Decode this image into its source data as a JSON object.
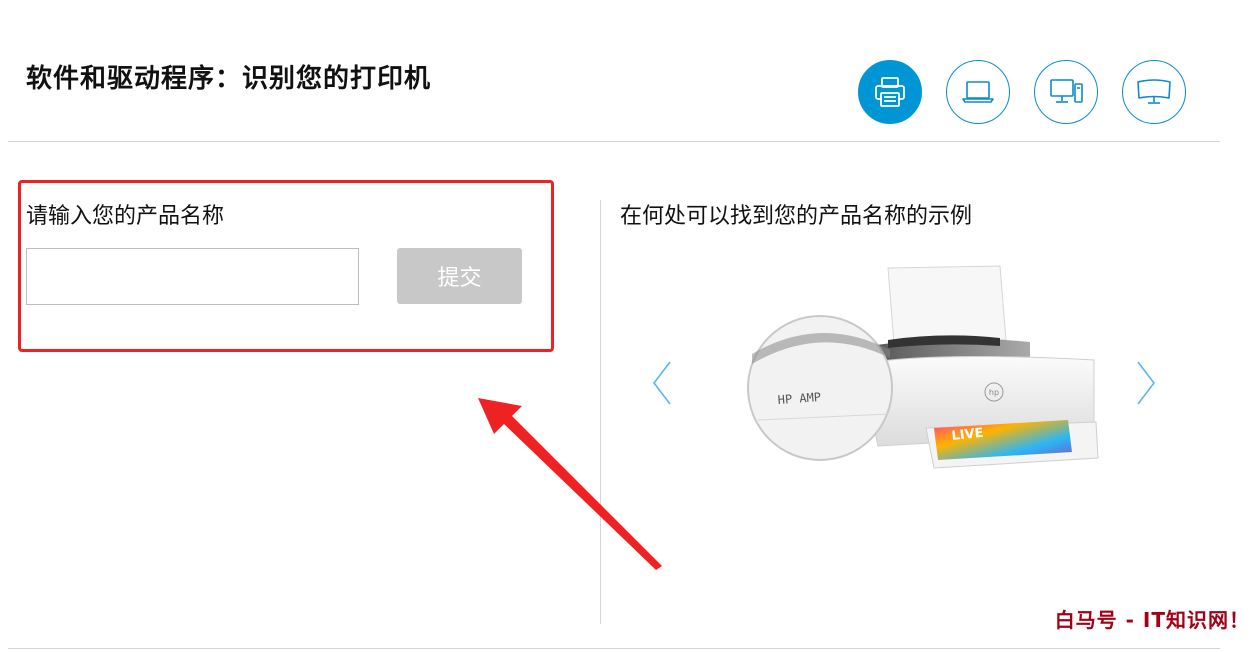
{
  "header": {
    "title": "软件和驱动程序：识别您的打印机",
    "device_tabs": [
      {
        "name": "printer",
        "active": true
      },
      {
        "name": "laptop",
        "active": false
      },
      {
        "name": "desktop",
        "active": false
      },
      {
        "name": "monitor",
        "active": false
      }
    ]
  },
  "form": {
    "label": "请输入您的产品名称",
    "input_value": "",
    "input_placeholder": "",
    "submit_label": "提交"
  },
  "example": {
    "title": "在何处可以找到您的产品名称的示例",
    "zoom_label": "HP AMP",
    "photo_print_text": "LIVE"
  },
  "watermark": "白马号 - IT知识网！",
  "colors": {
    "accent": "#0096d6",
    "highlight": "#ee2222",
    "button_disabled": "#c8c8c8",
    "watermark": "#a40016"
  }
}
